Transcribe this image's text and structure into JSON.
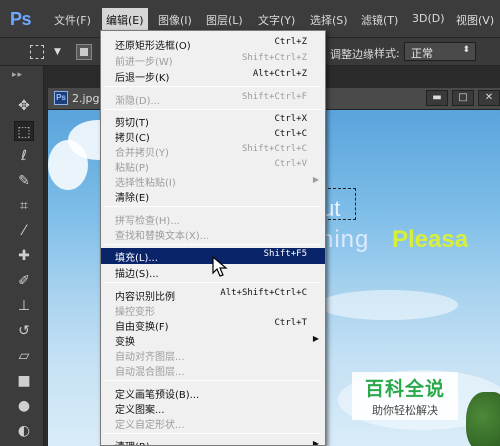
{
  "app": {
    "logo": "Ps"
  },
  "menubar": {
    "items": [
      "文件(F)",
      "编辑(E)",
      "图像(I)",
      "图层(L)",
      "文字(Y)",
      "选择(S)",
      "滤镜(T)",
      "3D(D)",
      "视图(V)"
    ],
    "active": "编辑(E)"
  },
  "options": {
    "edge_label": "调整边缘",
    "style_label": "样式:",
    "style_value": "正常"
  },
  "toolbar": {
    "tools": [
      "move-icon",
      "marquee-icon",
      "lasso-icon",
      "quick-select-icon",
      "crop-icon",
      "eyedropper-icon",
      "healing-brush-icon",
      "brush-icon",
      "clone-stamp-icon",
      "history-brush-icon",
      "eraser-icon",
      "gradient-icon",
      "blur-icon",
      "dodge-icon"
    ]
  },
  "document": {
    "tab_icon": "Ps",
    "tab_name": "2.jpg",
    "canvas_text_1": "ut",
    "canvas_text_2": "ning",
    "canvas_text_3": "Pleasa"
  },
  "edit_menu": {
    "items": [
      {
        "label": "还原矩形选框(O)",
        "shortcut": "Ctrl+Z",
        "disabled": false
      },
      {
        "label": "前进一步(W)",
        "shortcut": "Shift+Ctrl+Z",
        "disabled": true
      },
      {
        "label": "后退一步(K)",
        "shortcut": "Alt+Ctrl+Z",
        "disabled": false
      },
      {
        "label": "渐隐(D)...",
        "shortcut": "Shift+Ctrl+F",
        "disabled": true
      },
      {
        "label": "剪切(T)",
        "shortcut": "Ctrl+X",
        "disabled": false
      },
      {
        "label": "拷贝(C)",
        "shortcut": "Ctrl+C",
        "disabled": false
      },
      {
        "label": "合并拷贝(Y)",
        "shortcut": "Shift+Ctrl+C",
        "disabled": true
      },
      {
        "label": "粘贴(P)",
        "shortcut": "Ctrl+V",
        "disabled": true
      },
      {
        "label": "选择性粘贴(I)",
        "shortcut": "",
        "disabled": true
      },
      {
        "label": "清除(E)",
        "shortcut": "",
        "disabled": false
      },
      {
        "label": "拼写检查(H)...",
        "shortcut": "",
        "disabled": true
      },
      {
        "label": "查找和替换文本(X)...",
        "shortcut": "",
        "disabled": true
      },
      {
        "label": "填充(L)...",
        "shortcut": "Shift+F5",
        "disabled": false,
        "highlighted": true
      },
      {
        "label": "描边(S)...",
        "shortcut": "",
        "disabled": false
      },
      {
        "label": "内容识别比例",
        "shortcut": "Alt+Shift+Ctrl+C",
        "disabled": false
      },
      {
        "label": "操控变形",
        "shortcut": "",
        "disabled": true
      },
      {
        "label": "自由变换(F)",
        "shortcut": "Ctrl+T",
        "disabled": false
      },
      {
        "label": "变换",
        "shortcut": "",
        "disabled": false
      },
      {
        "label": "自动对齐图层...",
        "shortcut": "",
        "disabled": true
      },
      {
        "label": "自动混合图层...",
        "shortcut": "",
        "disabled": true
      },
      {
        "label": "定义画笔预设(B)...",
        "shortcut": "",
        "disabled": false
      },
      {
        "label": "定义图案...",
        "shortcut": "",
        "disabled": false
      },
      {
        "label": "定义自定形状...",
        "shortcut": "",
        "disabled": true
      },
      {
        "label": "清理(R)",
        "shortcut": "",
        "disabled": false
      }
    ]
  },
  "watermark": {
    "title": "百科全说",
    "subtitle": "助你轻松解决"
  }
}
